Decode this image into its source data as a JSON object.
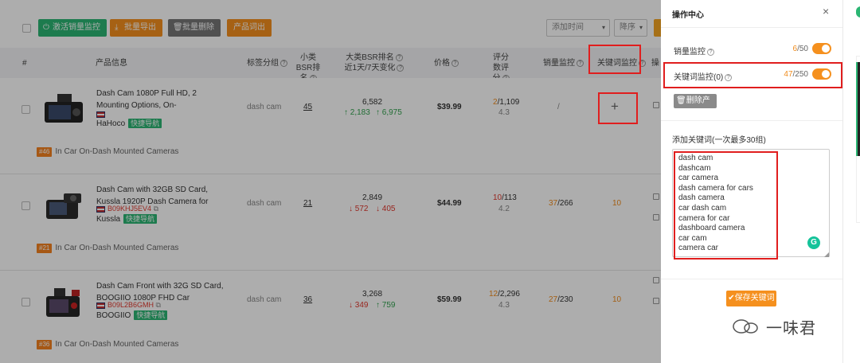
{
  "toolbar": {
    "activate_label": "激活销量监控",
    "export_label": "批量导出",
    "delete_label": "批量删除",
    "product_label": "产品词出",
    "sort_select": "添加时间",
    "order_select": "降序"
  },
  "table_headers": {
    "index": "#",
    "product": "产品信息",
    "tag": "标签分组",
    "small_bsr": "小类BSR排名",
    "big_bsr": "大类BSR排名",
    "big_bsr_sub": "近1天/7天变化",
    "price": "价格",
    "rating": "评分数评分",
    "sales_monitor": "销量监控",
    "keyword_monitor": "关键词监控",
    "op": "操"
  },
  "rows": [
    {
      "title": "Dash Cam 1080P Full HD, 2 Mounting Options, On-",
      "asin": "",
      "brand": "HaHoco",
      "quick": "快捷导航",
      "tag": "dash cam",
      "small_bsr": "45",
      "big_bsr": "6,582",
      "bsr_d1": "2,183",
      "bsr_d7": "6,975",
      "price": "$39.99",
      "rating_a": "2",
      "rating_b": "1,109",
      "score": "4.3",
      "sales": "/",
      "keyword": "+",
      "rank": "#46",
      "category": "In Car On-Dash Mounted Cameras"
    },
    {
      "title": "Dash Cam with 32GB SD Card, Kussla 1920P Dash Camera for",
      "asin": "B09KHJ5EV4",
      "brand": "Kussla",
      "quick": "快捷导航",
      "tag": "dash cam",
      "small_bsr": "21",
      "big_bsr": "2,849",
      "bsr_d1": "572",
      "bsr_d7": "405",
      "price": "$44.99",
      "rating_a": "10",
      "rating_b": "113",
      "score": "4.2",
      "sales_a": "37",
      "sales_b": "266",
      "keyword": "10",
      "rank": "#21",
      "category": "In Car On-Dash Mounted Cameras"
    },
    {
      "title": "Dash Cam Front with 32G SD Card, BOOGIIO 1080P FHD Car",
      "asin": "B09L2B6GMH",
      "brand": "BOOGIIO",
      "quick": "快捷导航",
      "tag": "dash cam",
      "small_bsr": "36",
      "big_bsr": "3,268",
      "bsr_d1": "349",
      "bsr_d7": "759",
      "price": "$59.99",
      "rating_a": "12",
      "rating_b": "2,296",
      "score": "4.3",
      "sales_a": "27",
      "sales_b": "230",
      "keyword": "10",
      "rank": "#36",
      "category": "In Car On-Dash Mounted Cameras"
    }
  ],
  "drawer": {
    "title": "操作中心",
    "close": "×",
    "sales_label": "销量监控",
    "sales_used": "6",
    "sales_total": "/50",
    "kw_label": "关键词监控(0)",
    "kw_used": "47",
    "kw_total": "/250",
    "delete_product": "删除产品",
    "add_kw_label": "添加关键词(一次最多30组)",
    "keywords": [
      "dash cam",
      "dashcam",
      "car camera",
      "dash camera for cars",
      "dash camera",
      "car dash cam",
      "camera for car",
      "dashboard camera",
      "car cam",
      "camera car"
    ],
    "save_label": "保存关键词"
  },
  "watermark": "一味君",
  "colors": {
    "accent": "#f5901e",
    "green": "#2bb673",
    "highlight": "#e01e1e"
  }
}
